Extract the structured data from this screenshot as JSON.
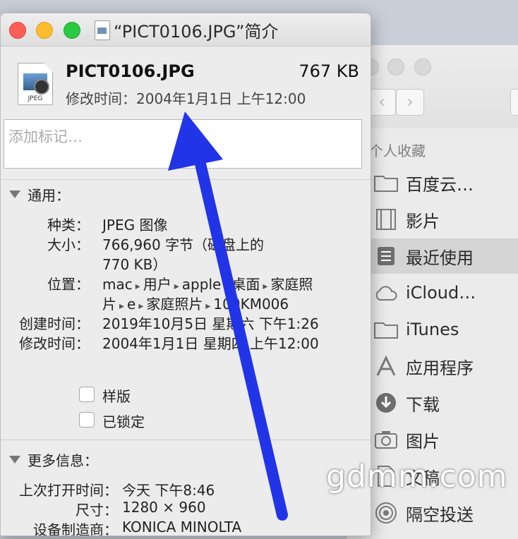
{
  "info_window": {
    "title": "“PICT0106.JPG”简介",
    "file": {
      "name": "PICT0106.JPG",
      "size": "767 KB",
      "modified": "修改时间：2004年1月1日 上午12:00",
      "icon_ext": "JPEG"
    },
    "tags_placeholder": "添加标记…",
    "general": {
      "header": "通用：",
      "kind_label": "种类：",
      "kind_value": "JPEG 图像",
      "size_label": "大小：",
      "size_value_line1": "766,960 字节（磁盘上的",
      "size_value_line2": "770 KB）",
      "where_label": "位置：",
      "where_line1": [
        "mac",
        "用户",
        "apple",
        "桌面",
        "家庭照"
      ],
      "where_line2": [
        "片",
        "e",
        "家庭照片",
        "100KM006"
      ],
      "created_label": "创建时间：",
      "created_value": "2019年10月5日 星期六 下午1:26",
      "modified_label": "修改时间：",
      "modified_value": "2004年1月1日 星期四 上午12:00",
      "stationery_label": "样版",
      "locked_label": "已锁定"
    },
    "more_info": {
      "header": "更多信息：",
      "last_opened_label": "上次打开时间：",
      "last_opened_value": "今天 下午8:46",
      "dimensions_label": "尺寸：",
      "dimensions_value": "1280 × 960",
      "device_make_label": "设备制造商：",
      "device_make_value": "KONICA MINOLTA"
    }
  },
  "finder_sidebar": {
    "section_title": "个人收藏",
    "items": [
      {
        "label": "百度云…",
        "icon": "folder-icon"
      },
      {
        "label": "影片",
        "icon": "film-icon"
      },
      {
        "label": "最近使用",
        "icon": "recents-icon",
        "selected": true
      },
      {
        "label": "iCloud…",
        "icon": "cloud-icon"
      },
      {
        "label": "iTunes",
        "icon": "folder-icon"
      },
      {
        "label": "应用程序",
        "icon": "applications-icon"
      },
      {
        "label": "下载",
        "icon": "download-icon"
      },
      {
        "label": "图片",
        "icon": "camera-icon"
      },
      {
        "label": "文稿",
        "icon": "document-icon"
      },
      {
        "label": "隔空投送",
        "icon": "airdrop-icon"
      }
    ]
  },
  "watermark": "gdmm.com",
  "colors": {
    "arrow": "#2234e8",
    "close": "#fc5f57",
    "minimize": "#fdbc2e",
    "maximize": "#2ac841"
  }
}
